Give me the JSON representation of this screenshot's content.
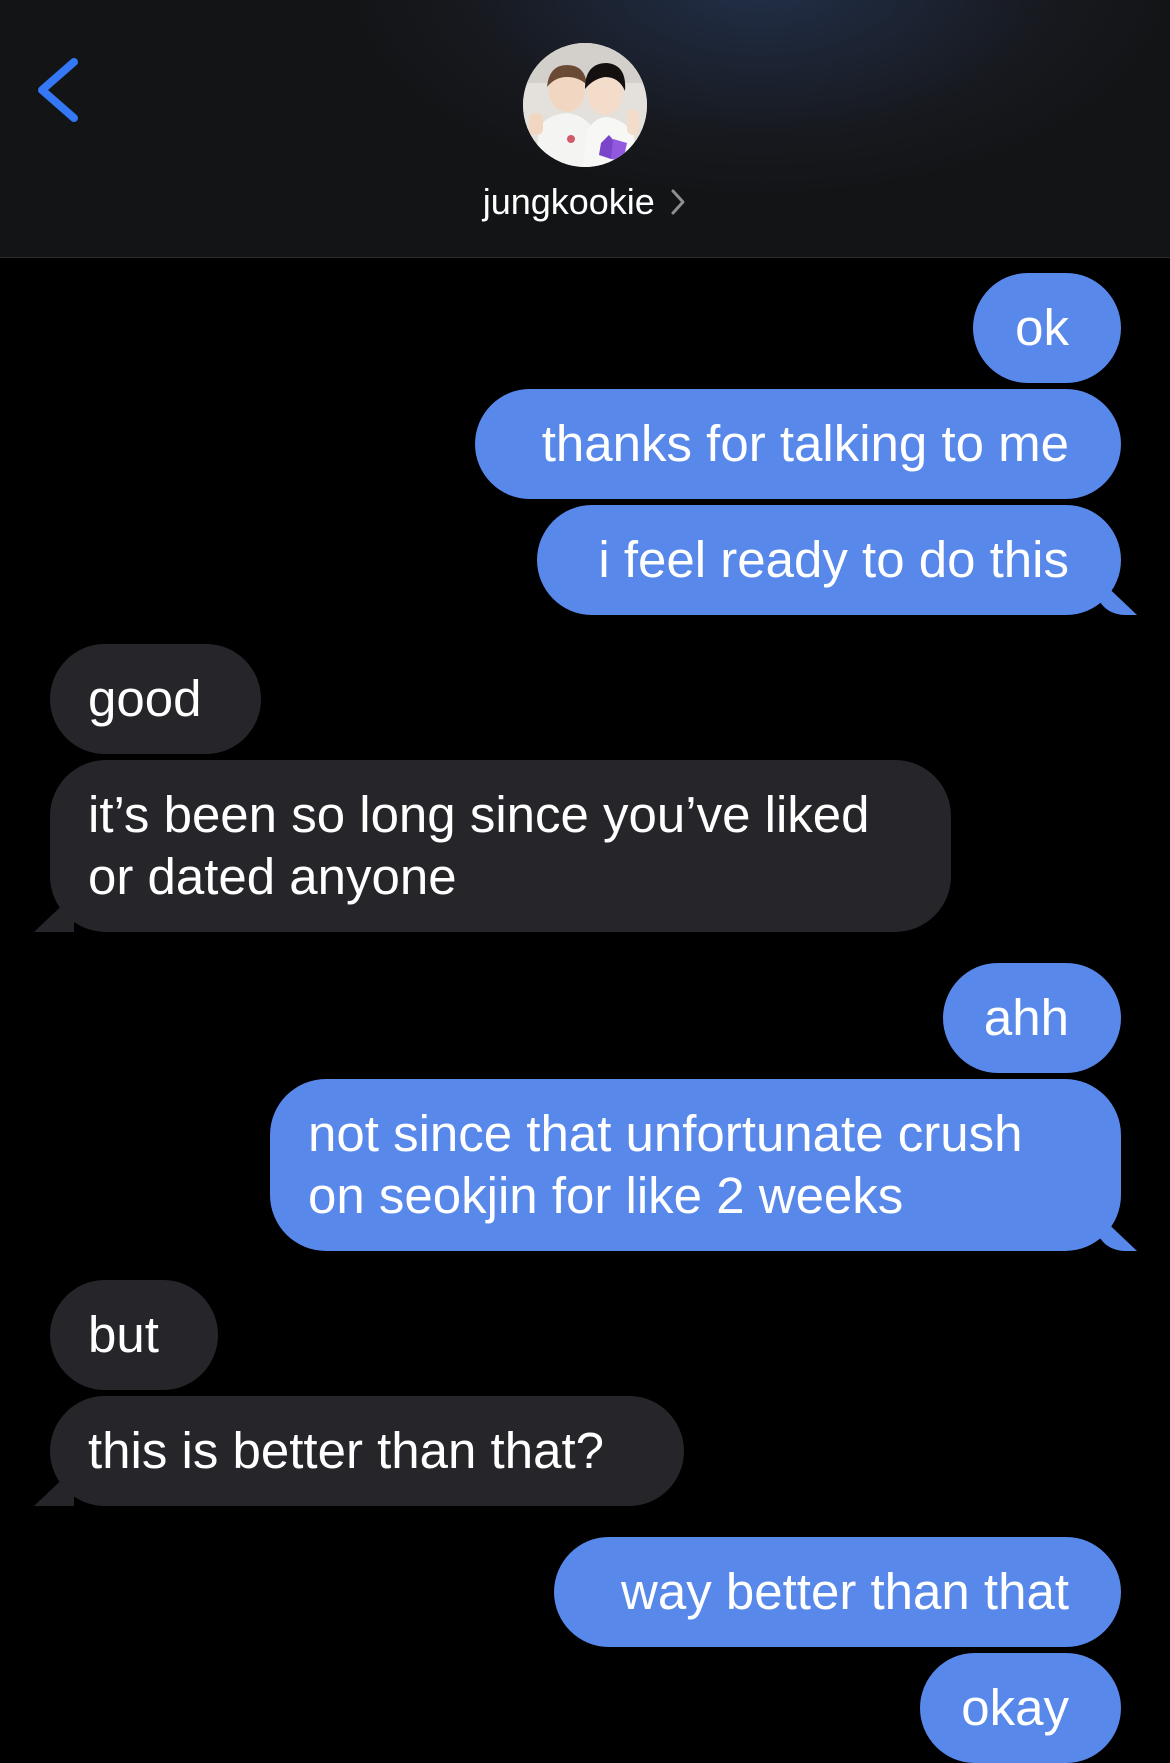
{
  "header": {
    "contact_name": "jungkookie",
    "back_icon": "chevron-left-icon",
    "name_chevron_icon": "chevron-right-icon",
    "accent_color": "#3478f6"
  },
  "colors": {
    "sent_bubble": "#5888ea",
    "received_bubble": "#26252a",
    "background": "#000000"
  },
  "messages": [
    {
      "direction": "sent",
      "text": "ok"
    },
    {
      "direction": "sent",
      "text": "thanks for talking to me"
    },
    {
      "direction": "sent",
      "text": "i feel ready to do this"
    },
    {
      "direction": "received",
      "text": "good"
    },
    {
      "direction": "received",
      "text": "it’s been so long since you’ve liked or dated anyone",
      "lines": [
        "it’s been so long since you’ve liked",
        "or dated anyone"
      ]
    },
    {
      "direction": "sent",
      "text": "ahh"
    },
    {
      "direction": "sent",
      "text": "not since that unfortunate crush on seokjin for like 2 weeks",
      "lines": [
        "not since that unfortunate crush",
        "on seokjin for like 2 weeks"
      ]
    },
    {
      "direction": "received",
      "text": "but"
    },
    {
      "direction": "received",
      "text": "this is better than that?"
    },
    {
      "direction": "sent",
      "text": "way better than that"
    },
    {
      "direction": "sent",
      "text": "okay"
    }
  ]
}
